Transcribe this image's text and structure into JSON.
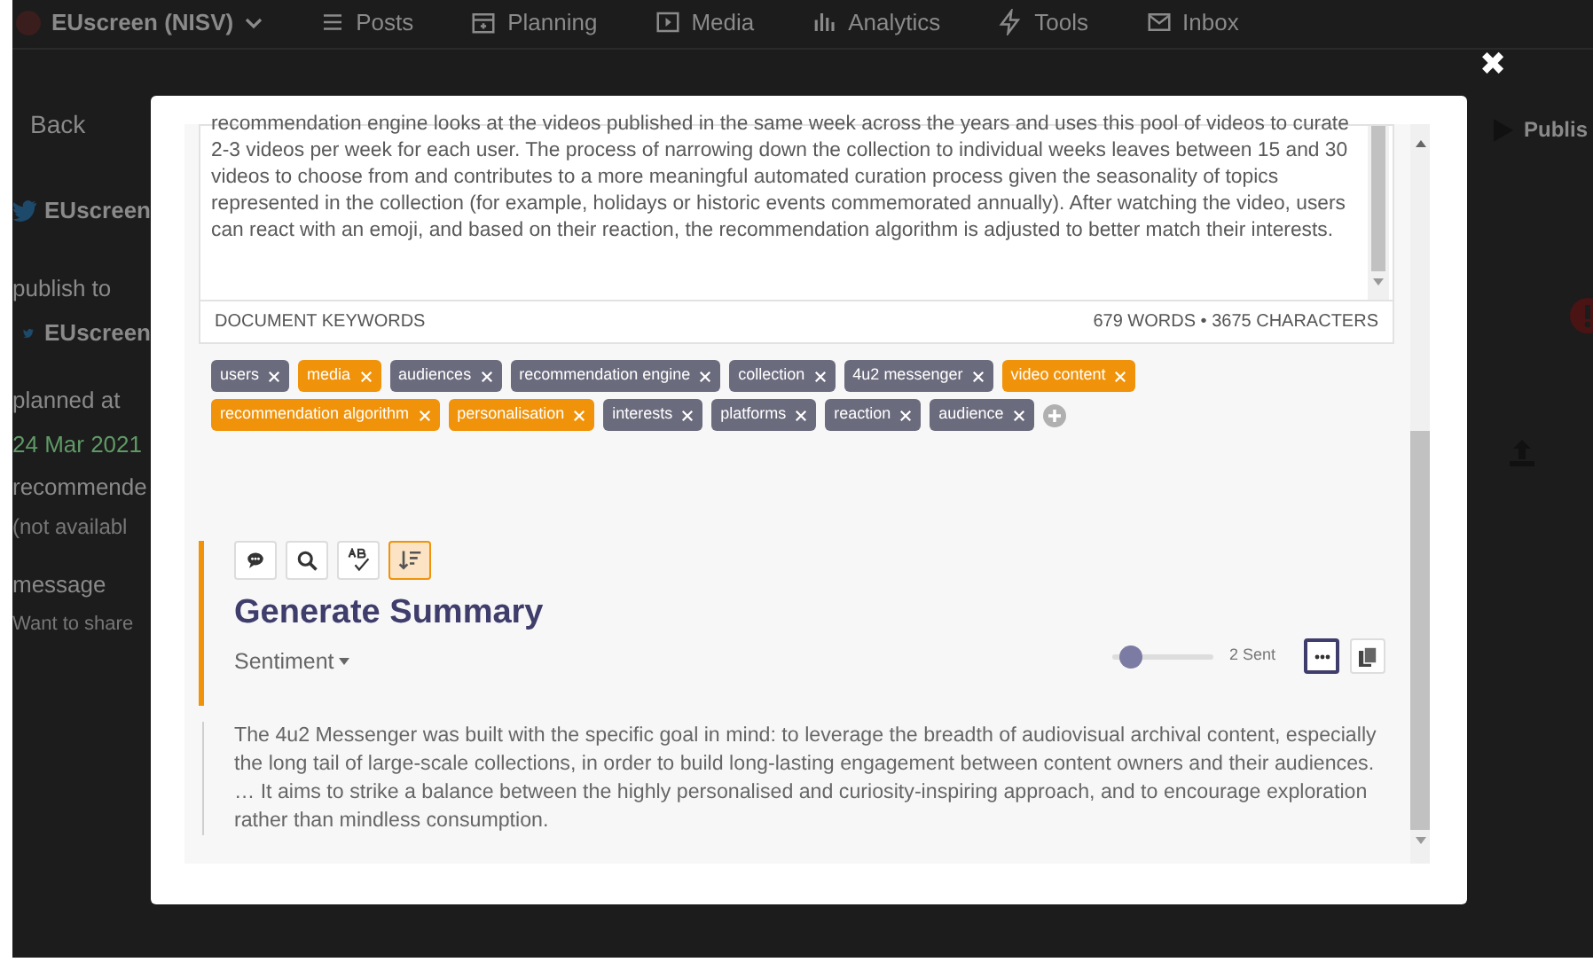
{
  "background": {
    "nav": {
      "account": "EUscreen (NISV)",
      "items": [
        {
          "label": "Posts"
        },
        {
          "label": "Planning"
        },
        {
          "label": "Media"
        },
        {
          "label": "Analytics"
        },
        {
          "label": "Tools"
        },
        {
          "label": "Inbox"
        }
      ]
    },
    "back": "Back",
    "publish": "Publis",
    "account": "EUscreen",
    "publish_to_label": "publish to",
    "publish_to": "EUscreen",
    "planned_label": "planned at",
    "planned": "24 Mar 2021",
    "recommended_label": "recommende",
    "recommended": "(not availabl",
    "message_label": "message",
    "message_placeholder": "Want to share"
  },
  "modal": {
    "close": "✖",
    "document": {
      "text": "recommendation engine looks at the videos published in the same week across the years and uses this pool of videos to curate 2-3 videos per week for each user. The process of narrowing down the collection to individual weeks leaves between 15 and 30 videos to choose from and contributes to a more meaningful automated curation process given the seasonality of topics represented in the collection (for example, holidays or historic events commemorated annually). After watching the video, users can react with an emoji, and based on their reaction, the recommendation algorithm is adjusted to better match their interests.",
      "keywords_label": "DOCUMENT KEYWORDS",
      "stats": "679 WORDS • 3675 CHARACTERS"
    },
    "keywords": [
      {
        "label": "users",
        "highlighted": false
      },
      {
        "label": "media",
        "highlighted": true
      },
      {
        "label": "audiences",
        "highlighted": false
      },
      {
        "label": "recommendation engine",
        "highlighted": false
      },
      {
        "label": "collection",
        "highlighted": false
      },
      {
        "label": "4u2 messenger",
        "highlighted": false
      },
      {
        "label": "video content",
        "highlighted": true
      },
      {
        "label": "recommendation algorithm",
        "highlighted": true
      },
      {
        "label": "personalisation",
        "highlighted": true
      },
      {
        "label": "interests",
        "highlighted": false
      },
      {
        "label": "platforms",
        "highlighted": false
      },
      {
        "label": "reaction",
        "highlighted": false
      },
      {
        "label": "audience",
        "highlighted": false
      }
    ],
    "tools": [
      {
        "selected": false
      },
      {
        "selected": false
      },
      {
        "selected": false
      },
      {
        "selected": true
      }
    ],
    "title": "Generate Summary",
    "mode": "Sentiment",
    "slider": {
      "level": 0.15,
      "reading": "2 Sent"
    },
    "summary": "The 4u2 Messenger was built with the specific goal in mind: to leverage the breadth of audiovisual archival content, especially the long tail of large-scale collections, in order to build long-lasting engagement between content owners and their audiences. … It aims to strike a balance between the highly personalised and curiosity-inspiring approach, and to encourage exploration rather than mindless consumption."
  }
}
